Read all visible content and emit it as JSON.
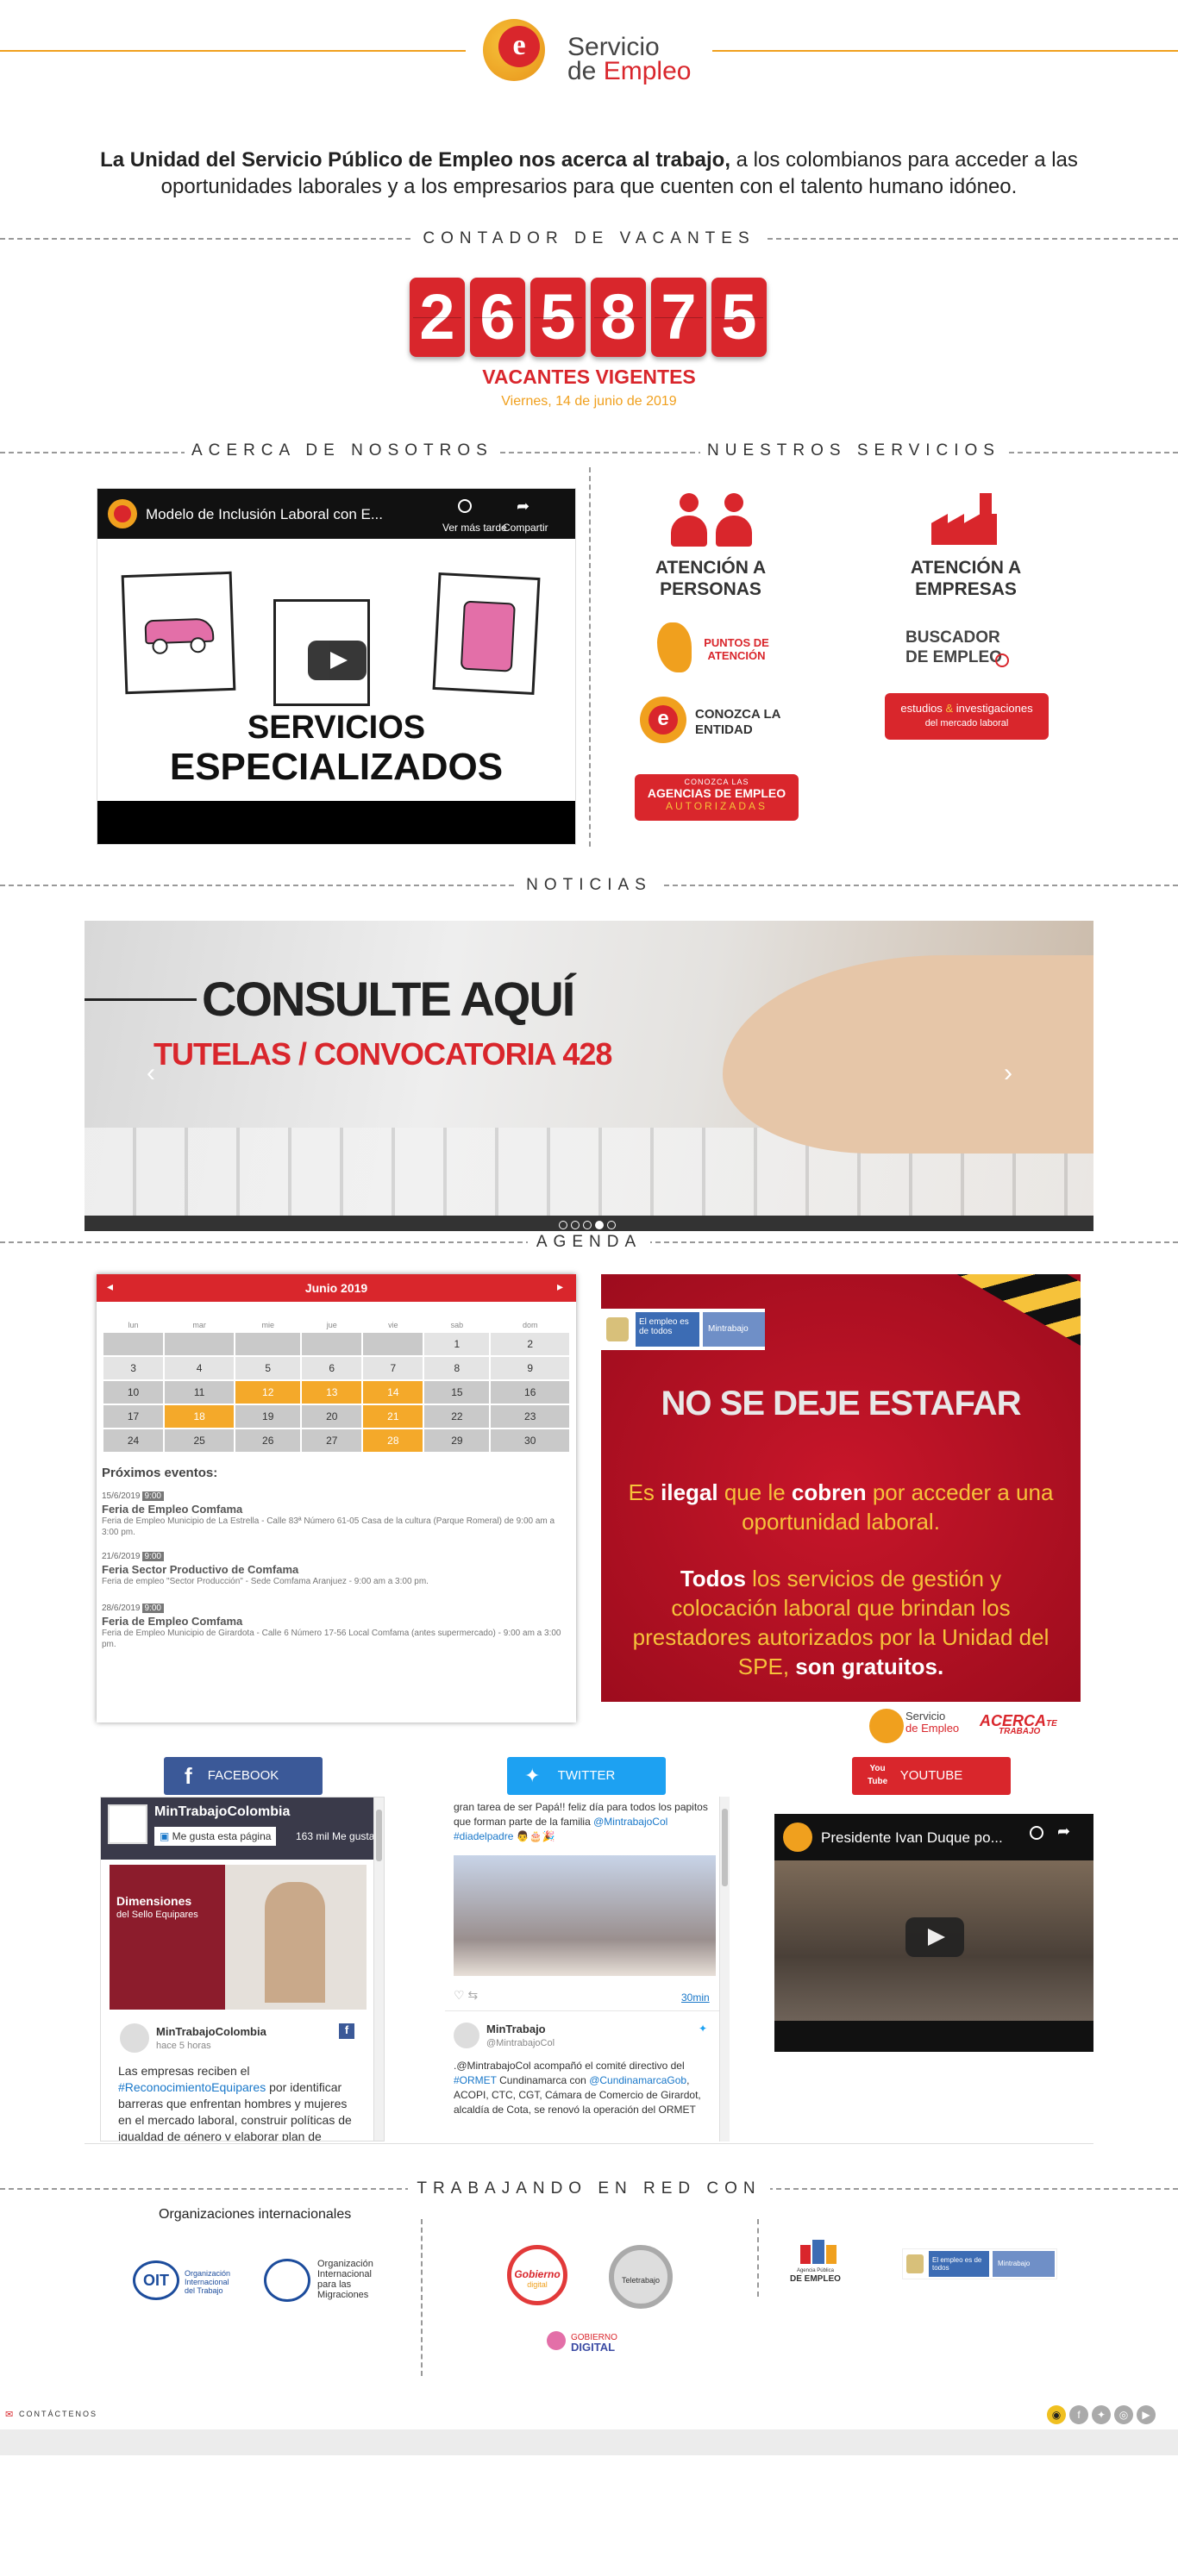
{
  "header": {
    "brand_line1": "Servicio",
    "brand_line2_a": "de ",
    "brand_line2_b": "Empleo",
    "logo_letter": "e"
  },
  "intro": {
    "bold": "La Unidad del Servicio Público de Empleo nos acerca al trabajo,",
    "rest": " a los colombianos para acceder a las oportunidades laborales y a los empresarios para que cuenten con el talento humano idóneo."
  },
  "counter": {
    "title": "CONTADOR DE VACANTES",
    "digits": [
      "2",
      "6",
      "5",
      "8",
      "7",
      "5"
    ],
    "label": "VACANTES VIGENTES",
    "date": "Viernes, 14 de junio de 2019"
  },
  "about": {
    "title": "ACERCA DE NOSOTROS",
    "video_title": "Modelo de Inclusión Laboral con E...",
    "watch_later": "Ver más tarde",
    "share": "Compartir",
    "thumb_line1": "SERVICIOS",
    "thumb_line2": "ESPECIALIZADOS"
  },
  "services": {
    "title": "NUESTROS SERVICIOS",
    "personas": "ATENCIÓN A PERSONAS",
    "empresas": "ATENCIÓN A EMPRESAS",
    "puntos": "PUNTOS DE ATENCIÓN",
    "buscador": "BUSCADOR DE EMPLEO",
    "conozca": "CONOZCA LA ENTIDAD",
    "estudios_a": "estudios ",
    "estudios_amp": "&",
    "estudios_b": " investigaciones",
    "estudios_c": "del mercado laboral",
    "agencias_top": "CONOZCA LAS",
    "agencias_mid": "AGENCIAS DE EMPLEO",
    "agencias_bot": "AUTORIZADAS"
  },
  "news": {
    "title": "NOTICIAS",
    "headline": "CONSULTE AQUÍ",
    "subheadline": "TUTELAS / CONVOCATORIA 428"
  },
  "agenda": {
    "title": "AGENDA",
    "month": "Junio 2019",
    "weekdays": [
      "lun",
      "mar",
      "mie",
      "jue",
      "vie",
      "sab",
      "dom"
    ],
    "upcoming": "Próximos eventos:",
    "events": [
      {
        "date": "15/6/2019",
        "time": "9:00",
        "title": "Feria de Empleo Comfama",
        "desc": "Feria de Empleo Municipio de La Estrella - Calle 83ª Número 61-05 Casa de la cultura (Parque Romeral) de 9:00 am a 3:00 pm."
      },
      {
        "date": "21/6/2019",
        "time": "9:00",
        "title": "Feria Sector Productivo de Comfama",
        "desc": "Feria de empleo \"Sector Producción\" - Sede Comfama Aranjuez - 9:00 am a 3:00 pm."
      },
      {
        "date": "28/6/2019",
        "time": "9:00",
        "title": "Feria de Empleo Comfama",
        "desc": "Feria de Empleo Municipio de Girardota - Calle 6 Número 17-56 Local Comfama (antes supermercado) - 9:00 am a 3:00 pm."
      }
    ]
  },
  "banner": {
    "logo_a": "El empleo es de todos",
    "logo_b": "Mintrabajo",
    "headline": "NO SE DEJE ESTAFAR",
    "p1_a": "Es ",
    "p1_b": "ilegal",
    "p1_c": " que le ",
    "p1_d": "cobren",
    "p1_e": " por acceder a una oportunidad laboral.",
    "p2_a": "Todos",
    "p2_b": " los servicios de gestión y colocación laboral que brindan los prestadores autorizados por la Unidad del SPE, ",
    "p2_c": "son gratuitos.",
    "foot_brand_a": "Servicio",
    "foot_brand_b": "de Empleo",
    "foot_acerca": "ACERCA",
    "foot_te": "TE",
    "foot_trabajo": "TRABAJO"
  },
  "social": {
    "facebook": {
      "tab": "FACEBOOK",
      "page": "MinTrabajoColombia",
      "like": "Me gusta esta página",
      "likes": "163 mil Me gusta",
      "post_title": "Dimensiones",
      "post_sub": "del Sello Equipares",
      "author": "MinTrabajoColombia",
      "time": "hace 5 horas",
      "text_a": "Las empresas reciben el ",
      "hashtag": "#ReconocimientoEquipares",
      "text_b": " por identificar barreras que enfrentan hombres y mujeres en el mercado laboral, construir políticas de igualdad de género y elaborar plan de"
    },
    "twitter": {
      "tab": "TWITTER",
      "top_text": "gran tarea de ser Papá!! feliz día para todos los papitos que forman parte de la familia ",
      "top_mention": "@MintrabajoCol",
      "top_tag": "#diadelpadre",
      "time": "30min",
      "author": "MinTrabajo",
      "handle": "@MintrabajoCol",
      "t2_a": ".@MintrabajoCol acompañó el comité directivo del ",
      "t2_tag": "#ORMET",
      "t2_b": " Cundinamarca con ",
      "t2_m": "@CundinamarcaGob",
      "t2_c": ", ACOPI, CTC, CGT, Cámara de Comercio de Girardot, alcaldía de Cota, se renovó la operación del ORMET"
    },
    "youtube": {
      "tab": "YOUTUBE",
      "logo_a": "You",
      "logo_b": "Tube",
      "video_title": "Presidente Ivan Duque po..."
    }
  },
  "network": {
    "title": "TRABAJANDO EN RED CON",
    "orgs_title": "Organizaciones internacionales",
    "oit_1": "Organización",
    "oit_2": "Internacional",
    "oit_3": "del Trabajo",
    "oim_1": "Organización",
    "oim_2": "Internacional",
    "oim_3": "para las",
    "oim_4": "Migraciones",
    "gob_1": "Gobierno",
    "gob_2": "digital",
    "tele": "Teletrabajo",
    "gobdig_1": "GOBIERNO",
    "gobdig_2": "DIGITAL",
    "agencia_1": "Agencia Pública",
    "agencia_2": "DE EMPLEO",
    "mintrab_a": "El empleo es de todos",
    "mintrab_b": "Mintrabajo"
  },
  "footer": {
    "contact": "CONTÁCTENOS"
  },
  "colors": {
    "accent_red": "#d9262c",
    "accent_orange": "#f0a01e",
    "facebook": "#3b5998",
    "twitter": "#1da1f2"
  }
}
